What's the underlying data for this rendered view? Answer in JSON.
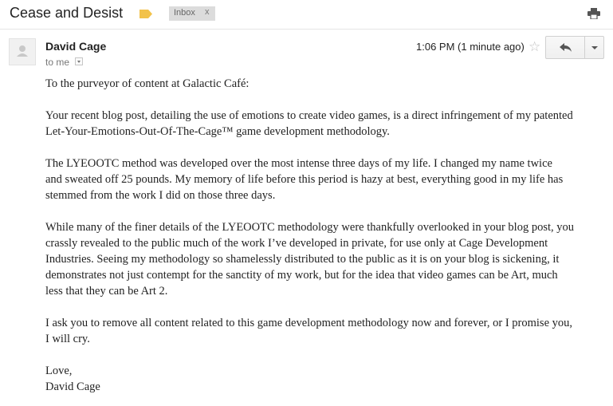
{
  "email": {
    "subject": "Cease and Desist",
    "label": "Inbox",
    "label_remove": "x",
    "sender_name": "David Cage",
    "recipient": "to me",
    "time": "1:06 PM (1 minute ago)",
    "body": {
      "p1": "To the purveyor of content at Galactic Café:",
      "p2": "Your recent blog post, detailing the use of emotions to create video games, is a direct infringement of my patented\nLet-Your-Emotions-Out-Of-The-Cage™ game development methodology.",
      "p3": "The LYEOOTC method was developed over the most intense three days of my life. I changed my name twice\nand sweated off 25 pounds. My memory of life before this period is hazy at best, everything good in my life has\nstemmed from the work I did on those three days.",
      "p4": "While many of the finer details of the LYEOOTC methodology were thankfully overlooked in your blog post, you\ncrassly revealed to the public much of the work I’ve developed in private, for use only at Cage Development\nIndustries. Seeing my methodology so shamelessly distributed to the public as it is on your blog is sickening, it\ndemonstrates not just contempt for the sanctity of my work, but for the idea that video games can be Art, much\nless that they can be Art 2.",
      "p5": "I ask you to remove all content related to this game development methodology now and forever, or I promise you,\nI will cry.",
      "signoff": "Love,",
      "signature": "David Cage"
    }
  },
  "icons": {
    "label": "label-tag-icon",
    "print": "print-icon",
    "star": "star-icon",
    "reply": "reply-icon",
    "more": "chevron-down-icon",
    "avatar": "avatar-placeholder"
  },
  "colors": {
    "label_tag": "#f2c24a",
    "chip_bg": "#dcdcdc",
    "star": "#c2c2c2"
  }
}
